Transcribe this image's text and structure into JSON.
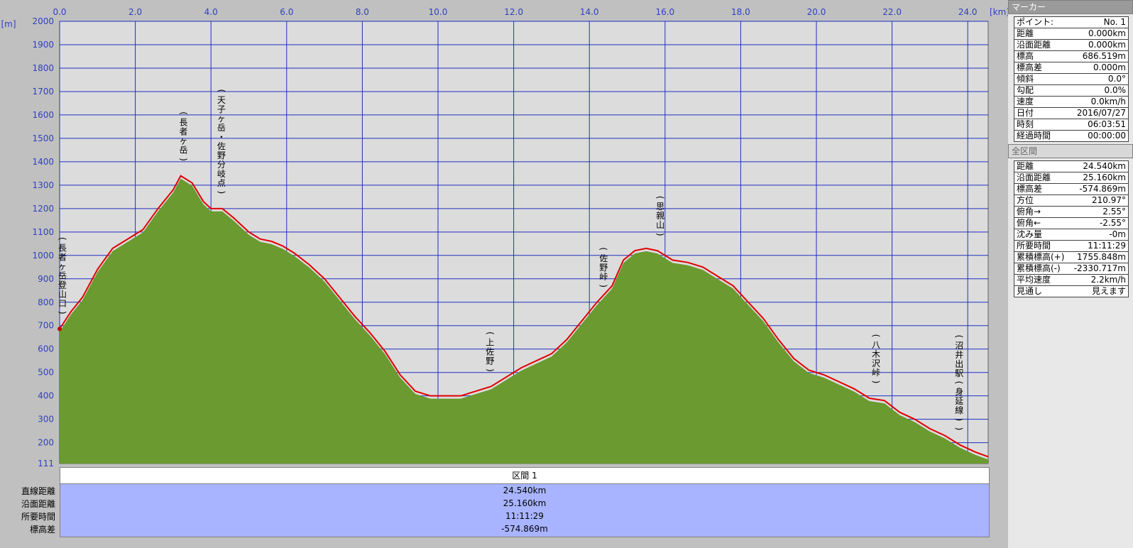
{
  "chart_data": {
    "type": "area",
    "xlabel_unit": "[km]",
    "ylabel_unit": "[m]",
    "xlim": [
      0,
      24.54
    ],
    "ylim": [
      111,
      2000
    ],
    "x_ticks": [
      "0.0",
      "2.0",
      "4.0",
      "6.0",
      "8.0",
      "10.0",
      "12.0",
      "14.0",
      "16.0",
      "18.0",
      "20.0",
      "22.0",
      "24.0"
    ],
    "x_tick_values": [
      0,
      2,
      4,
      6,
      8,
      10,
      12,
      14,
      16,
      18,
      20,
      22,
      24
    ],
    "y_ticks": [
      "2000",
      "1900",
      "1800",
      "1700",
      "1600",
      "1500",
      "1400",
      "1300",
      "1200",
      "1100",
      "1000",
      "900",
      "800",
      "700",
      "600",
      "500",
      "400",
      "300",
      "200",
      "111"
    ],
    "y_tick_values": [
      2000,
      1900,
      1800,
      1700,
      1600,
      1500,
      1400,
      1300,
      1200,
      1100,
      1000,
      900,
      800,
      700,
      600,
      500,
      400,
      300,
      200,
      111
    ],
    "series": [
      {
        "x": [
          0,
          0.3,
          0.6,
          1.0,
          1.4,
          1.8,
          2.2,
          2.6,
          3.0,
          3.2,
          3.5,
          3.8,
          4.0,
          4.3,
          4.6,
          5.0,
          5.3,
          5.6,
          5.9,
          6.2,
          6.6,
          7.0,
          7.4,
          7.8,
          8.2,
          8.6,
          9.0,
          9.4,
          9.8,
          10.2,
          10.6,
          11.0,
          11.4,
          11.8,
          12.2,
          12.6,
          13.0,
          13.4,
          13.8,
          14.2,
          14.6,
          14.9,
          15.2,
          15.5,
          15.8,
          16.2,
          16.6,
          17.0,
          17.4,
          17.8,
          18.2,
          18.6,
          19.0,
          19.4,
          19.8,
          20.2,
          20.6,
          21.0,
          21.4,
          21.8,
          22.2,
          22.6,
          23.0,
          23.4,
          23.8,
          24.2,
          24.54
        ],
        "y": [
          686,
          760,
          820,
          940,
          1030,
          1070,
          1110,
          1200,
          1280,
          1340,
          1310,
          1230,
          1200,
          1200,
          1160,
          1100,
          1070,
          1060,
          1040,
          1010,
          960,
          900,
          820,
          740,
          670,
          590,
          490,
          420,
          400,
          400,
          400,
          420,
          440,
          480,
          520,
          550,
          580,
          640,
          720,
          800,
          870,
          980,
          1020,
          1030,
          1020,
          980,
          970,
          950,
          910,
          870,
          800,
          730,
          640,
          560,
          510,
          490,
          460,
          430,
          390,
          380,
          330,
          300,
          260,
          230,
          190,
          160,
          140
        ]
      }
    ],
    "annotations": [
      {
        "x": 0.0,
        "label": "(長者ヶ岳登山口)"
      },
      {
        "x": 3.2,
        "label": "(長者ヶ岳)"
      },
      {
        "x": 4.2,
        "label": "(天子ヶ岳・佐野分岐点)"
      },
      {
        "x": 14.3,
        "label": "(佐野峠)"
      },
      {
        "x": 15.8,
        "label": "(思親山)"
      },
      {
        "x": 11.3,
        "label": "(上佐野)"
      },
      {
        "x": 21.5,
        "label": "(八木沢峠)"
      },
      {
        "x": 23.7,
        "label": "(沼井出駅(身延線))"
      }
    ]
  },
  "summary": {
    "header": "区間 1",
    "labels": [
      "直線距離",
      "沿面距離",
      "所要時間",
      "標高差"
    ],
    "values": [
      "24.540km",
      "25.160km",
      "11:11:29",
      "-574.869m"
    ]
  },
  "marker_panel": {
    "title": "マーカー",
    "rows": [
      {
        "k": "ポイント:",
        "v": "No. 1"
      },
      {
        "k": "距離",
        "v": "0.000km"
      },
      {
        "k": "沿面距離",
        "v": "0.000km"
      },
      {
        "k": "標高",
        "v": "686.519m"
      },
      {
        "k": "標高差",
        "v": "0.000m"
      },
      {
        "k": "傾斜",
        "v": "0.0°"
      },
      {
        "k": "勾配",
        "v": "0.0%"
      },
      {
        "k": "速度",
        "v": "0.0km/h"
      },
      {
        "k": "日付",
        "v": "2016/07/27"
      },
      {
        "k": "時刻",
        "v": "06:03:51"
      },
      {
        "k": "経過時間",
        "v": "00:00:00"
      }
    ]
  },
  "total_panel": {
    "title": "全区間",
    "rows": [
      {
        "k": "距離",
        "v": "24.540km"
      },
      {
        "k": "沿面距離",
        "v": "25.160km"
      },
      {
        "k": "標高差",
        "v": "-574.869m"
      },
      {
        "k": "方位",
        "v": "210.97°"
      },
      {
        "k": "俯角→",
        "v": "2.55°"
      },
      {
        "k": "俯角←",
        "v": "-2.55°"
      },
      {
        "k": "沈み量",
        "v": "-0m"
      },
      {
        "k": "所要時間",
        "v": "11:11:29"
      },
      {
        "k": "累積標高(+)",
        "v": "1755.848m"
      },
      {
        "k": "累積標高(-)",
        "v": "-2330.717m"
      },
      {
        "k": "平均速度",
        "v": "2.2km/h"
      },
      {
        "k": "見通し",
        "v": "見えます"
      }
    ]
  },
  "colors": {
    "area": "#6a9a30",
    "track": "#e00000",
    "grid": "#2030c0",
    "plot_bg": "#dcdcdc"
  }
}
